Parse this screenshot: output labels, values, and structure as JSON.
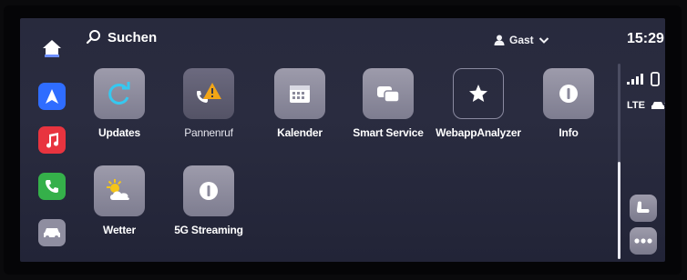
{
  "topbar": {
    "search_label": "Suchen",
    "user_label": "Gast",
    "time": "15:29"
  },
  "dock": {
    "items": [
      {
        "name": "home",
        "icon": "home-icon"
      },
      {
        "name": "navigation",
        "icon": "navigation-arrow-icon"
      },
      {
        "name": "media",
        "icon": "music-note-icon"
      },
      {
        "name": "phone",
        "icon": "phone-icon"
      },
      {
        "name": "car",
        "icon": "car-icon"
      }
    ]
  },
  "apps": [
    {
      "label": "Updates",
      "icon": "refresh-icon"
    },
    {
      "label": "Pannenruf",
      "icon": "warning-phone-icon"
    },
    {
      "label": "Kalender",
      "icon": "calendar-icon"
    },
    {
      "label": "Smart Service",
      "icon": "service-icon"
    },
    {
      "label": "WebappAnalyzer",
      "icon": "star-icon"
    },
    {
      "label": "Info",
      "icon": "info-icon"
    },
    {
      "label": "Wetter",
      "icon": "weather-icon"
    },
    {
      "label": "5G Streaming",
      "icon": "streaming-icon"
    }
  ],
  "status": {
    "network": "LTE"
  },
  "colors": {
    "accent_blue": "#2f6dff",
    "media_red": "#e8343f",
    "phone_green": "#35b04a",
    "warning_amber": "#f2a516",
    "refresh_cyan": "#36c8f0"
  }
}
